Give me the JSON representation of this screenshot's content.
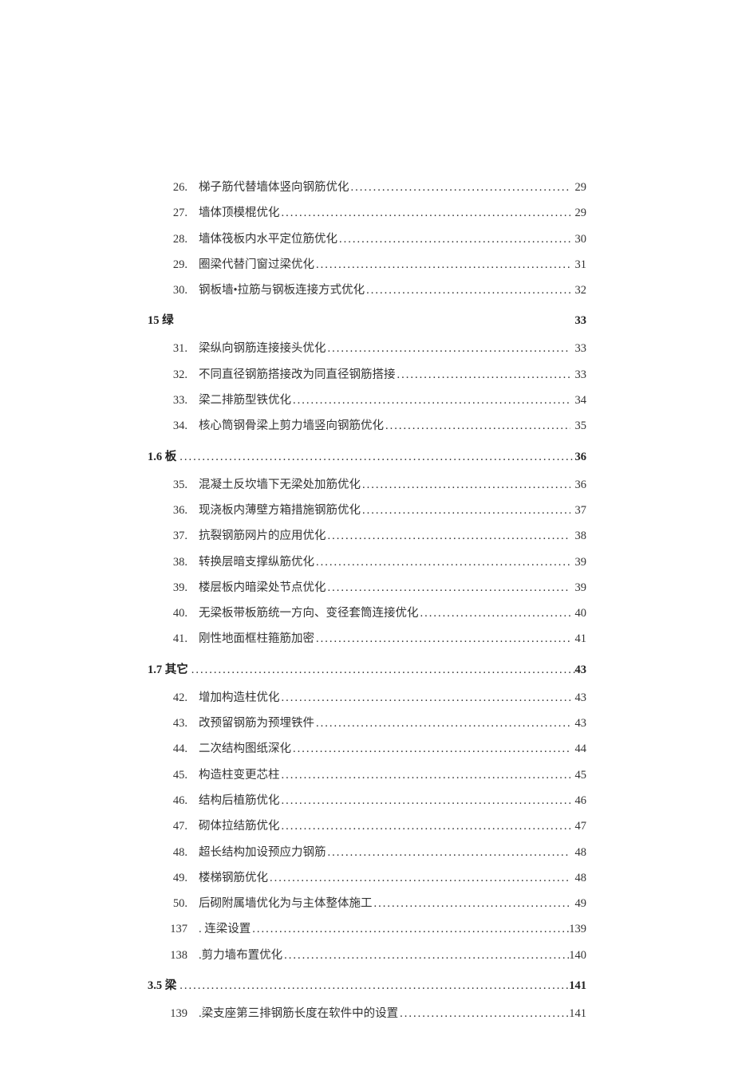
{
  "toc": {
    "items_a": [
      {
        "num": "26.",
        "text": "梯子筋代替墙体竖向钢筋优化",
        "page": "29"
      },
      {
        "num": "27.",
        "text": "墙体顶模棍优化",
        "page": "29"
      },
      {
        "num": "28.",
        "text": "墙体筏板内水平定位筋优化",
        "page": "30"
      },
      {
        "num": "29.",
        "text": "圈梁代替门窗过梁优化",
        "page": "31"
      },
      {
        "num": "30.",
        "text": "钢板墙•拉筋与钢板连接方式优化",
        "page": "32"
      }
    ],
    "section_b": {
      "label": "15 绿",
      "page": "33"
    },
    "items_b": [
      {
        "num": "31.",
        "text": "梁纵向钢筋连接接头优化",
        "page": "33"
      },
      {
        "num": "32.",
        "text": "不同直径钢筋搭接改为同直径钢筋搭接",
        "page": "33"
      },
      {
        "num": "33.",
        "text": "梁二排筋型铁优化",
        "page": "34"
      },
      {
        "num": "34.",
        "text": "核心筒钢骨梁上剪力墙竖向钢筋优化",
        "page": "35"
      }
    ],
    "section_c": {
      "label": "1.6 板",
      "page": "36"
    },
    "items_c": [
      {
        "num": "35.",
        "text": "混凝土反坎墙下无梁处加筋优化",
        "page": "36"
      },
      {
        "num": "36.",
        "text": "现浇板内薄壁方箱措施钢筋优化",
        "page": "37"
      },
      {
        "num": "37.",
        "text": "抗裂钢筋网片的应用优化",
        "page": "38"
      },
      {
        "num": "38.",
        "text": "转换层暗支撑纵筋优化",
        "page": "39"
      },
      {
        "num": "39.",
        "text": "楼层板内暗梁处节点优化",
        "page": "39"
      },
      {
        "num": "40.",
        "text": "无梁板带板筋统一方向、变径套筒连接优化",
        "page": "40"
      },
      {
        "num": "41.",
        "text": "刚性地面框柱箍筋加密",
        "page": "41"
      }
    ],
    "section_d": {
      "label": "1.7 其它",
      "page": "43"
    },
    "items_d": [
      {
        "num": "42.",
        "text": "增加构造柱优化",
        "page": "43"
      },
      {
        "num": "43.",
        "text": "改预留钢筋为预埋铁件",
        "page": "43"
      },
      {
        "num": "44.",
        "text": "二次结构图纸深化",
        "page": "44"
      },
      {
        "num": "45.",
        "text": "构造柱变更芯柱",
        "page": "45"
      },
      {
        "num": "46.",
        "text": "结构后植筋优化",
        "page": "46"
      },
      {
        "num": "47.",
        "text": "砌体拉结筋优化",
        "page": "47"
      },
      {
        "num": "48.",
        "text": "超长结构加设预应力钢筋",
        "page": "48"
      },
      {
        "num": "49.",
        "text": "楼梯钢筋优化",
        "page": "48"
      },
      {
        "num": "50.",
        "text": "后砌附属墙优化为与主体整体施工",
        "page": "49"
      },
      {
        "num": "137",
        "text": ". 连梁设置",
        "page": "139"
      },
      {
        "num": "138",
        "text": ".剪力墙布置优化",
        "page": "140"
      }
    ],
    "section_e": {
      "label": "3.5 梁",
      "page": "141"
    },
    "items_e": [
      {
        "num": "139",
        "text": ".梁支座第三排钢筋长度在软件中的设置",
        "page": "141"
      }
    ]
  }
}
